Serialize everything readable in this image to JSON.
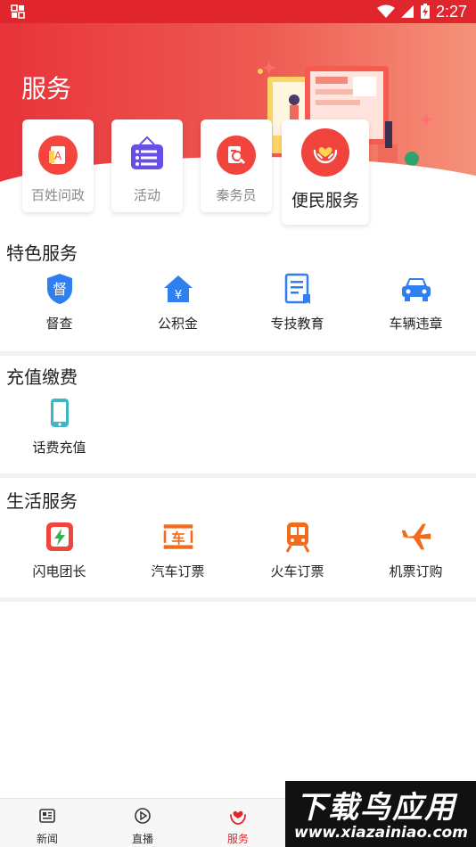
{
  "status_bar": {
    "time": "2:27"
  },
  "header": {
    "title": "服务"
  },
  "top_cards": [
    {
      "label": "百姓问政",
      "icon": "a-document-icon"
    },
    {
      "label": "活动",
      "icon": "list-ticket-icon"
    },
    {
      "label": "秦务员",
      "icon": "search-document-icon"
    },
    {
      "label": "便民服务",
      "icon": "heart-hands-icon"
    }
  ],
  "sections": {
    "featured": {
      "title": "特色服务",
      "items": [
        {
          "label": "督查",
          "icon": "supervise-badge-icon"
        },
        {
          "label": "公积金",
          "icon": "house-yen-icon"
        },
        {
          "label": "专技教育",
          "icon": "certificate-icon"
        },
        {
          "label": "车辆违章",
          "icon": "car-icon"
        }
      ]
    },
    "recharge": {
      "title": "充值缴费",
      "items": [
        {
          "label": "话费充值",
          "icon": "mobile-phone-icon"
        }
      ]
    },
    "life": {
      "title": "生活服务",
      "items": [
        {
          "label": "闪电团长",
          "icon": "lightning-bag-icon"
        },
        {
          "label": "汽车订票",
          "icon": "bus-ticket-icon"
        },
        {
          "label": "火车订票",
          "icon": "train-icon"
        },
        {
          "label": "机票订购",
          "icon": "airplane-icon"
        }
      ]
    }
  },
  "bottom_nav": [
    {
      "label": "新闻",
      "icon": "news-icon",
      "active": false
    },
    {
      "label": "直播",
      "icon": "play-circle-icon",
      "active": false
    },
    {
      "label": "服务",
      "icon": "heart-hands-icon",
      "active": true
    }
  ],
  "watermark": {
    "title": "下载鸟应用",
    "url": "www.xiazainiao.com"
  },
  "colors": {
    "brand_red": "#e0262c",
    "blue": "#2f7ff0",
    "teal": "#3fb6c2",
    "orange": "#f26a1b"
  }
}
